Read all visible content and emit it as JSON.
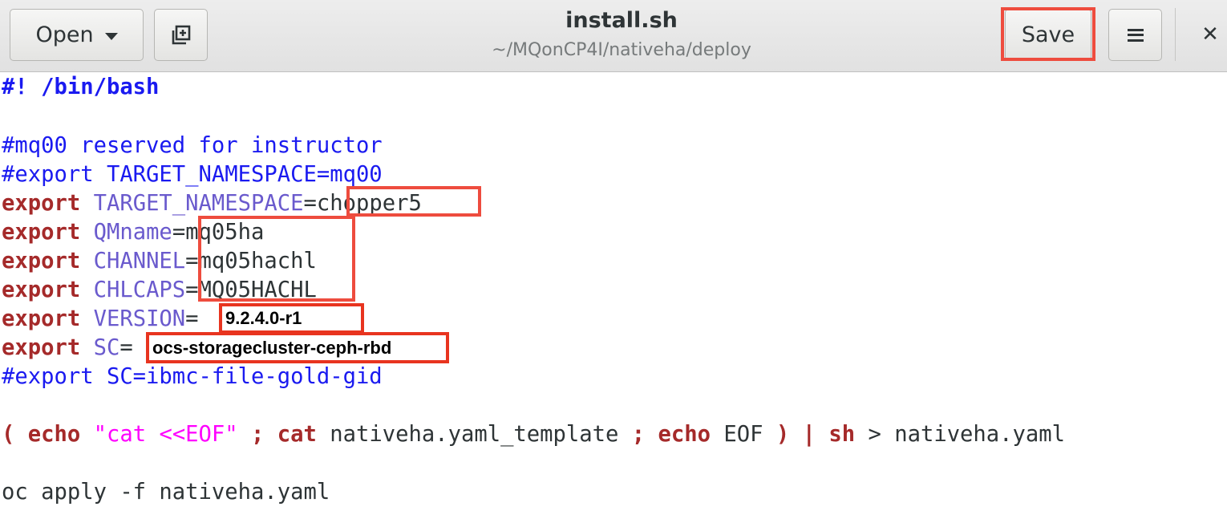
{
  "header": {
    "open_label": "Open",
    "save_label": "Save",
    "title": "install.sh",
    "subtitle": "~/MQonCP4I/nativeha/deploy",
    "icons": {
      "open_dropdown": "chevron-down-icon",
      "new_tab": "new-tab-icon",
      "menu": "hamburger-menu-icon",
      "close": "close-icon"
    }
  },
  "editor": {
    "shebang": "#! /bin/bash",
    "comment_reserved": "#mq00 reserved for instructor",
    "comment_export_ns": "#export TARGET_NAMESPACE=mq00",
    "export_kw": "export",
    "line_ns": {
      "var": "TARGET_NAMESPACE",
      "eq": "=",
      "value": "chopper5"
    },
    "line_qm": {
      "var": "QMname",
      "eq": "=",
      "value": "mq05ha"
    },
    "line_channel": {
      "var": "CHANNEL",
      "eq": "=",
      "value": "mq05hachl"
    },
    "line_chlcaps": {
      "var": "CHLCAPS",
      "eq": "=",
      "value": "MQ05HACHL"
    },
    "line_version": {
      "var": "VERSION",
      "eq": "=",
      "value": "9.2.4.0-r1"
    },
    "line_sc": {
      "var": "SC",
      "eq": "=",
      "value": "ocs-storagecluster-ceph-rbd"
    },
    "comment_export_sc": "#export SC=ibmc-file-gold-gid",
    "pipeline": {
      "open_paren": "(",
      "echo1": "echo",
      "str": "\"cat <<EOF\"",
      "semi1": ";",
      "cat": "cat",
      "arg": "nativeha.yaml_template",
      "semi2": ";",
      "echo2": "echo",
      "eof": "EOF",
      "close_paren": ")",
      "pipe": "|",
      "sh": "sh",
      "redirect": "> nativeha.yaml"
    },
    "apply": "oc apply -f nativeha.yaml"
  },
  "colors": {
    "highlight": "#ee4c3e",
    "comment": "#1a1af0",
    "keyword": "#a52a2a",
    "variable": "#6a5acd",
    "string": "#ff00ff"
  }
}
